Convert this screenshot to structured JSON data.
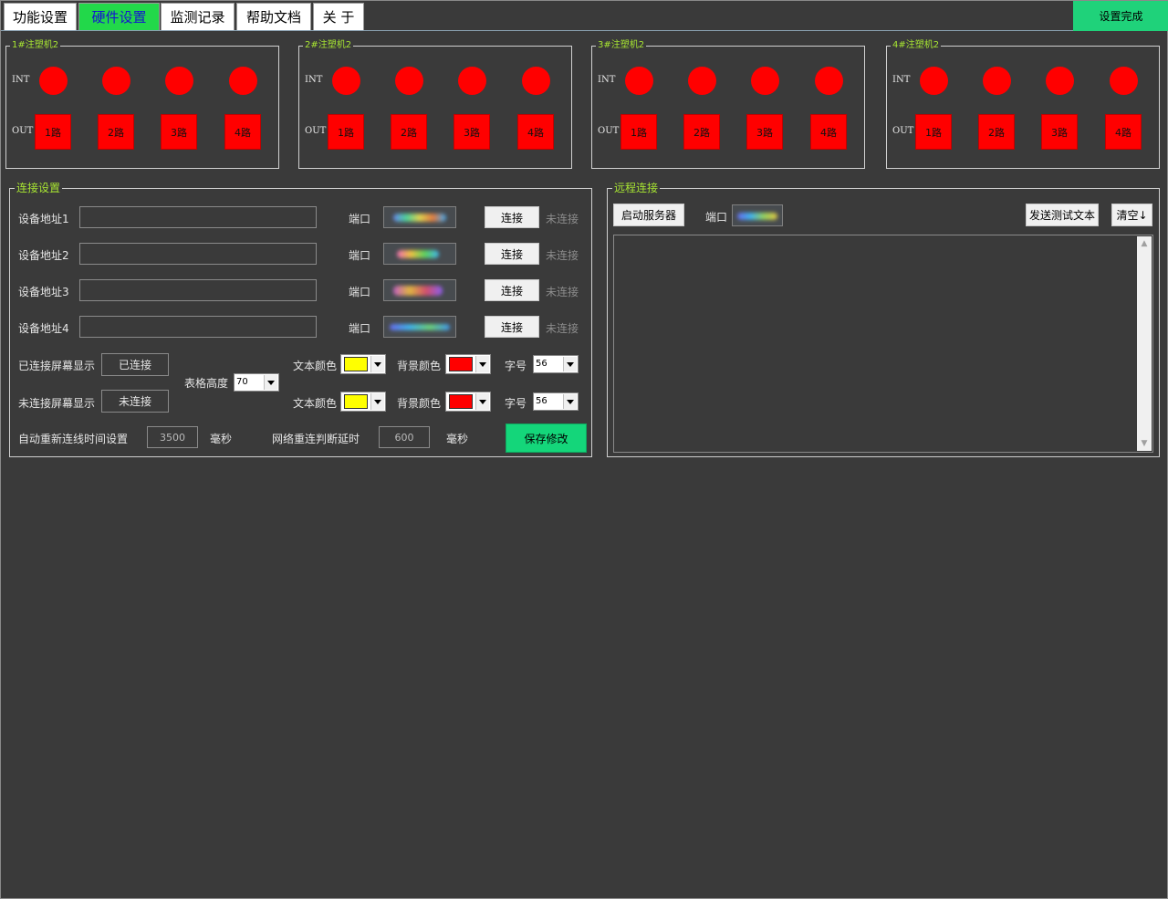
{
  "tabs": [
    {
      "label": "功能设置",
      "active": false
    },
    {
      "label": "硬件设置",
      "active": true
    },
    {
      "label": "监测记录",
      "active": false
    },
    {
      "label": "帮助文档",
      "active": false
    },
    {
      "label": "关 于",
      "active": false
    }
  ],
  "done_button": "设置完成",
  "machines": [
    {
      "title": "1#注塑机2",
      "int_label": "INT",
      "out_label": "OUT",
      "outputs": [
        "1路",
        "2路",
        "3路",
        "4路"
      ]
    },
    {
      "title": "2#注塑机2",
      "int_label": "INT",
      "out_label": "OUT",
      "outputs": [
        "1路",
        "2路",
        "3路",
        "4路"
      ]
    },
    {
      "title": "3#注塑机2",
      "int_label": "INT",
      "out_label": "OUT",
      "outputs": [
        "1路",
        "2路",
        "3路",
        "4路"
      ]
    },
    {
      "title": "4#注塑机2",
      "int_label": "INT",
      "out_label": "OUT",
      "outputs": [
        "1路",
        "2路",
        "3路",
        "4路"
      ]
    }
  ],
  "connection": {
    "title": "连接设置",
    "devices": [
      {
        "label": "设备地址1",
        "value": "",
        "port_label": "端口",
        "button": "连接",
        "status": "未连接"
      },
      {
        "label": "设备地址2",
        "value": "",
        "port_label": "端口",
        "button": "连接",
        "status": "未连接"
      },
      {
        "label": "设备地址3",
        "value": "",
        "port_label": "端口",
        "button": "连接",
        "status": "未连接"
      },
      {
        "label": "设备地址4",
        "value": "",
        "port_label": "端口",
        "button": "连接",
        "status": "未连接"
      }
    ],
    "connected_display_label": "已连接屏幕显示",
    "connected_display_value": "已连接",
    "disconnected_display_label": "未连接屏幕显示",
    "disconnected_display_value": "未连接",
    "table_height_label": "表格高度",
    "table_height_value": "70",
    "text_color_label": "文本颜色",
    "bg_color_label": "背景颜色",
    "font_size_label": "字号",
    "connected_text_color": "#ffff00",
    "connected_bg_color": "#ff0000",
    "connected_font_size": "56",
    "disconnected_text_color": "#ffff00",
    "disconnected_bg_color": "#ff0000",
    "disconnected_font_size": "56",
    "auto_reconnect_label": "自动重新连线时间设置",
    "auto_reconnect_value": "3500",
    "ms_unit": "毫秒",
    "net_delay_label": "网络重连判断延时",
    "net_delay_value": "600",
    "save_button": "保存修改"
  },
  "remote": {
    "title": "远程连接",
    "start_button": "启动服务器",
    "port_label": "端口",
    "send_button": "发送测试文本",
    "clear_button": "清空↓",
    "log_text": ""
  },
  "colors": {
    "background": "#3a3a3a",
    "accent_green": "#14d67a",
    "legend_text": "#a8e632",
    "led_red": "#ff0000"
  }
}
